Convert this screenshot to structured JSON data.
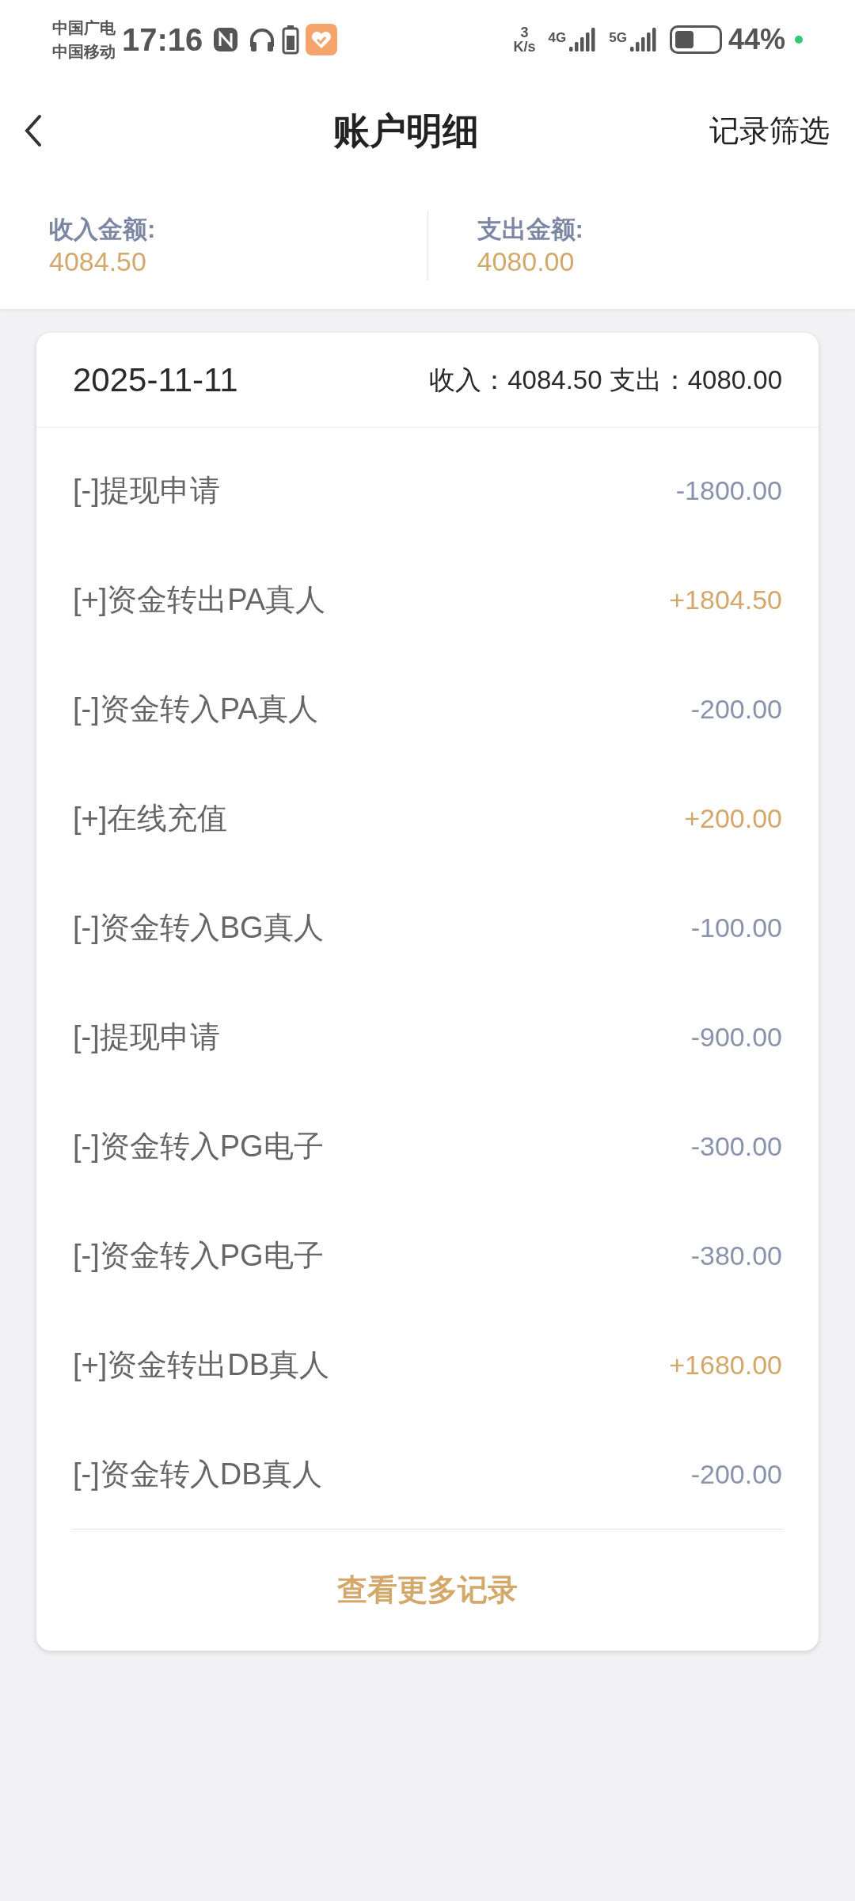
{
  "status_bar": {
    "carriers": [
      "中国广电",
      "中国移动"
    ],
    "time": "17:16",
    "speed_value": "3",
    "speed_unit": "K/s",
    "networks": [
      "4G",
      "5G"
    ],
    "battery": "44%"
  },
  "header": {
    "title": "账户明细",
    "action": "记录筛选"
  },
  "summary": [
    {
      "label": "收入金额:",
      "value": "4084.50"
    },
    {
      "label": "支出金额:",
      "value": "4080.00"
    }
  ],
  "day": {
    "date": "2025-11-11",
    "totals": "收入：4084.50 支出：4080.00",
    "rows": [
      {
        "title": "[-]提现申请",
        "amount": "-1800.00",
        "kind": "expense"
      },
      {
        "title": "[+]资金转出PA真人",
        "amount": "+1804.50",
        "kind": "income"
      },
      {
        "title": "[-]资金转入PA真人",
        "amount": "-200.00",
        "kind": "expense"
      },
      {
        "title": "[+]在线充值",
        "amount": "+200.00",
        "kind": "income"
      },
      {
        "title": "[-]资金转入BG真人",
        "amount": "-100.00",
        "kind": "expense"
      },
      {
        "title": "[-]提现申请",
        "amount": "-900.00",
        "kind": "expense"
      },
      {
        "title": "[-]资金转入PG电子",
        "amount": "-300.00",
        "kind": "expense"
      },
      {
        "title": "[-]资金转入PG电子",
        "amount": "-380.00",
        "kind": "expense"
      },
      {
        "title": "[+]资金转出DB真人",
        "amount": "+1680.00",
        "kind": "income"
      },
      {
        "title": "[-]资金转入DB真人",
        "amount": "-200.00",
        "kind": "expense"
      }
    ],
    "more": "查看更多记录"
  }
}
